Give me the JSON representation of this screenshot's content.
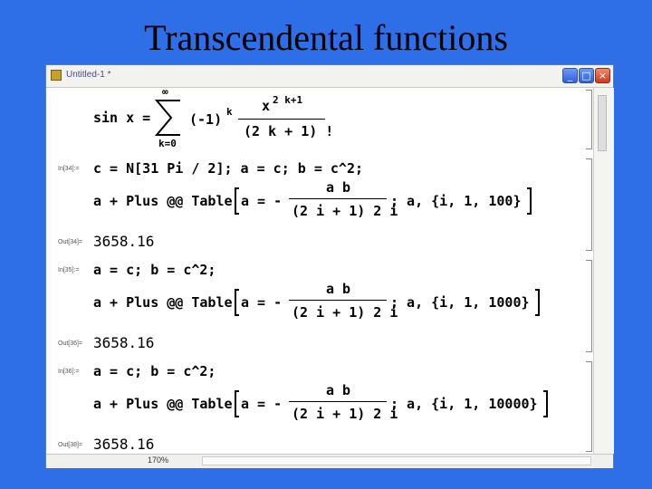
{
  "slide": {
    "title": "Transcendental functions"
  },
  "window": {
    "title": "Untitled-1 *",
    "controls": {
      "minimize": "_",
      "maximize": "□",
      "close": "×"
    }
  },
  "status": {
    "zoom": "170%"
  },
  "formula": {
    "lhs": "sin x =",
    "upper_limit": "∞",
    "lower_limit": "k=0",
    "sign": "(-1)",
    "sign_exp": "k",
    "num_base": "x",
    "num_exp": "2 k+1",
    "denominator": "(2 k + 1) !"
  },
  "cells": [
    {
      "in_label": "In[34]:=",
      "line1": "c = N[31 Pi / 2]; a = c; b = c^2;",
      "prefix": "a + Plus @@ Table",
      "bracket_lhs": "a = -",
      "numerator": "a b",
      "denominator": "(2 i + 1) 2 i",
      "iterator": "; a, {i, 1, 100}",
      "out_label": "Out[34]=",
      "output": "3658.16"
    },
    {
      "in_label": "In[35]:=",
      "line1": "a = c; b = c^2;",
      "prefix": "a + Plus @@ Table",
      "bracket_lhs": "a = -",
      "numerator": "a b",
      "denominator": "(2 i + 1) 2 i",
      "iterator": "; a, {i, 1, 1000}",
      "out_label": "Out[36]=",
      "output": "3658.16"
    },
    {
      "in_label": "In[36]:=",
      "line1": "a = c; b = c^2;",
      "prefix": "a + Plus @@ Table",
      "bracket_lhs": "a = -",
      "numerator": "a b",
      "denominator": "(2 i + 1) 2 i",
      "iterator": "; a, {i, 1, 10000}",
      "out_label": "Out[38]=",
      "output": "3658.16"
    }
  ]
}
